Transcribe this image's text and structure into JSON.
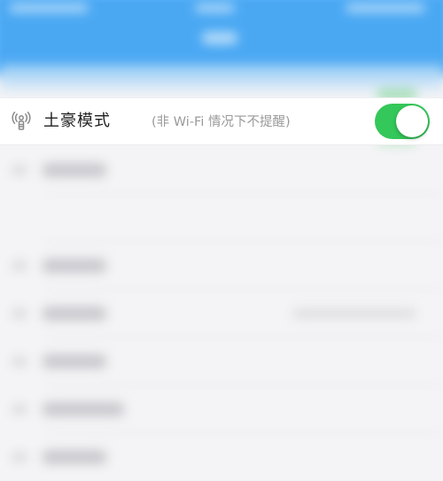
{
  "setting": {
    "title": "土豪模式",
    "hint": "(非 Wi-Fi 情况下不提醒)",
    "icon": "antenna-icon",
    "enabled": true,
    "accent_color": "#34c759"
  },
  "nav": {
    "background_color": "#4aa8f3"
  }
}
